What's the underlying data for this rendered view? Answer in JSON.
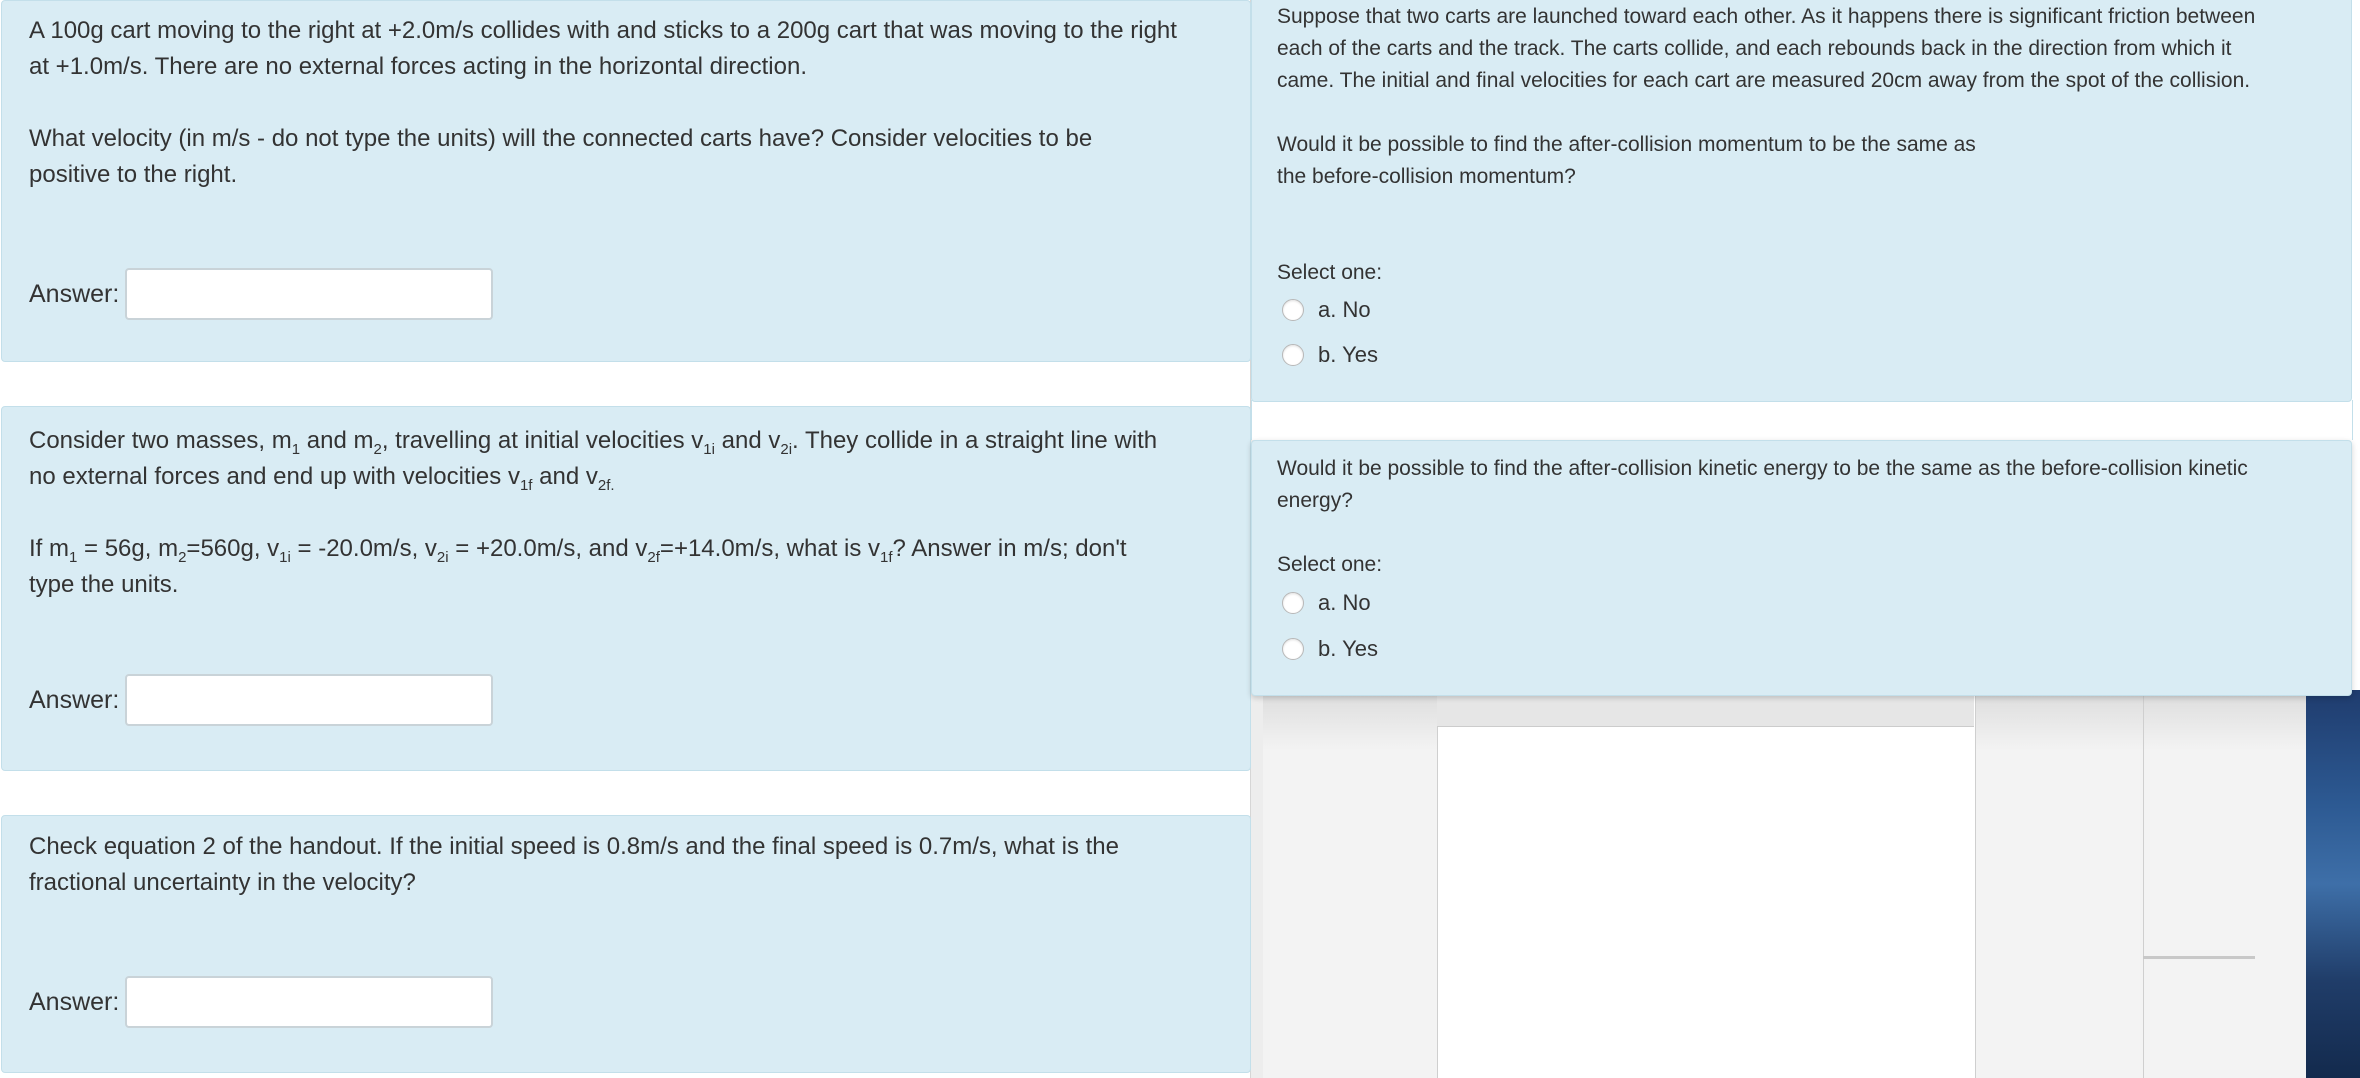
{
  "left": {
    "q1": {
      "line1": "A 100g cart moving to the right at +2.0m/s collides with and sticks to a 200g cart that was moving to the right",
      "line2": "at +1.0m/s.  There are no external forces acting in the horizontal direction.",
      "line3": "What velocity (in m/s  -  do not type the units) will the connected carts have?  Consider velocities to be",
      "line4": "positive to the right.",
      "answer_label": "Answer:",
      "answer_value": ""
    },
    "q2": {
      "answer_label": "Answer:",
      "answer_value": ""
    },
    "q3": {
      "line1": "Check equation 2 of the handout.  If the initial speed is 0.8m/s and the final speed is 0.7m/s, what is the",
      "line2": "fractional uncertainty in the velocity?",
      "answer_label": "Answer:",
      "answer_value": ""
    }
  },
  "right": {
    "q1": {
      "line1": "Suppose that two carts are launched toward each other.  As it happens there is significant friction between",
      "line2": "each of the carts and the track.  The carts collide, and each rebounds back in the direction from which it",
      "line3": "came.  The initial and final velocities for each cart are measured 20cm away from the spot of the collision.",
      "line4": "Would it be possible to find the after-collision momentum to be the same as",
      "line5": "the before-collision momentum?",
      "select_label": "Select one:",
      "option_a": "a. No",
      "option_b": "b. Yes"
    },
    "q2": {
      "line1": "Would it be possible to find the after-collision kinetic energy to be the same as the before-collision kinetic",
      "line2": "energy?",
      "select_label": "Select one:",
      "option_a": "a. No",
      "option_b": "b. Yes"
    }
  }
}
